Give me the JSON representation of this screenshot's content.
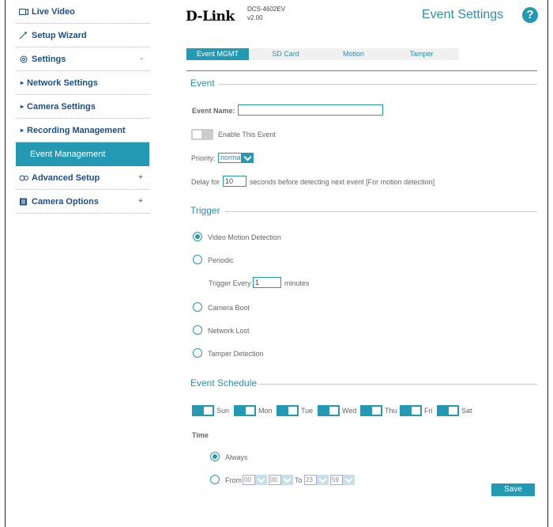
{
  "sidebar": {
    "items": [
      {
        "label": "Live Video",
        "icon": "camera-icon"
      },
      {
        "label": "Setup Wizard",
        "icon": "wand-icon"
      },
      {
        "label": "Settings",
        "icon": "gear-icon",
        "toggle": "-"
      },
      {
        "label": "Network Settings"
      },
      {
        "label": "Camera Settings"
      },
      {
        "label": "Recording Management"
      },
      {
        "label": "Event Management"
      },
      {
        "label": "Advanced Setup",
        "icon": "tools-icon",
        "toggle": "+"
      },
      {
        "label": "Camera Options",
        "icon": "list-icon",
        "toggle": "+"
      }
    ]
  },
  "header": {
    "logo": "D-Link",
    "model": "DCS-4602EV",
    "version": "v2.00",
    "title": "Event Settings",
    "help": "?"
  },
  "tabs": [
    "Event MGMT",
    "SD Card",
    "Motion",
    "Tamper"
  ],
  "event": {
    "title": "Event",
    "name_label": "Event Name:",
    "name_value": "",
    "enable_label": "Enable This Event",
    "priority_label": "Priority:",
    "priority_value": "normal",
    "delay_label": "Delay for",
    "delay_value": "10",
    "delay_suffix": "seconds before detecting next event [For motion detection]"
  },
  "trigger": {
    "title": "Trigger",
    "options": [
      "Video Motion Detection",
      "Periodic",
      "Camera Boot",
      "Network Lost",
      "Tamper Detection"
    ],
    "selected": "Video Motion Detection",
    "every_label": "Trigger Every",
    "every_value": "1",
    "every_unit": "minutes"
  },
  "schedule": {
    "title": "Event Schedule",
    "days": [
      "Sun",
      "Mon",
      "Tue",
      "Wed",
      "Thu",
      "Fri",
      "Sat"
    ],
    "time_label": "Time",
    "always_label": "Always",
    "from_label": "From",
    "to_label": "To",
    "from_hour": "00",
    "from_min": "00",
    "to_hour": "23",
    "to_min": "59"
  },
  "save_label": "Save",
  "colors": {
    "accent": "#2499b3",
    "link": "#1a4f8a"
  }
}
